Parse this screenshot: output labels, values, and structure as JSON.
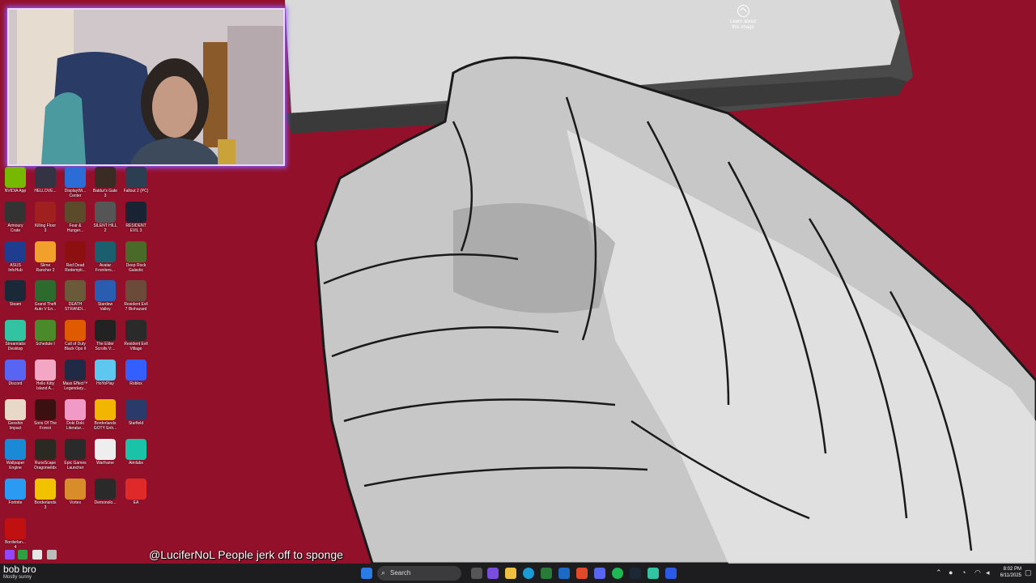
{
  "wallpaper": {
    "learn_label": "Learn about\nthis image"
  },
  "desktop_icons": [
    {
      "label": "NVIDIA App",
      "icon": "nvidia-icon",
      "color": "#76b900"
    },
    {
      "label": "HELLOVE...",
      "icon": "hellove-icon",
      "color": "#334"
    },
    {
      "label": "DisplayWi...\nCenter",
      "icon": "display-icon",
      "color": "#2b6cd6"
    },
    {
      "label": "Baldur's Gate\n3",
      "icon": "baldurs-gate-icon",
      "color": "#3a2b24"
    },
    {
      "label": "Fallout 2 (PC)",
      "icon": "fallout-icon",
      "color": "#2c3f52"
    },
    {
      "label": "Armoury\nCrate",
      "icon": "armoury-crate-icon",
      "color": "#333"
    },
    {
      "label": "Killing Floor\n3",
      "icon": "killing-floor-icon",
      "color": "#a02020"
    },
    {
      "label": "Fear &\nHunger...",
      "icon": "fear-hunger-icon",
      "color": "#5c4b2a"
    },
    {
      "label": "SILENT HILL\n2",
      "icon": "silent-hill-icon",
      "color": "#555"
    },
    {
      "label": "RESIDENT\nEVIL 3",
      "icon": "resident-evil-3-icon",
      "color": "#1a2333"
    },
    {
      "label": "ASUS\nInfoHub",
      "icon": "asus-icon",
      "color": "#1e3d8f"
    },
    {
      "label": "Slime\nRancher 2",
      "icon": "slime-rancher-icon",
      "color": "#f1a02b"
    },
    {
      "label": "Red Dead\nRedempti...",
      "icon": "red-dead-icon",
      "color": "#8c1010"
    },
    {
      "label": "Avatar\nFrontiers...",
      "icon": "avatar-icon",
      "color": "#1b5f6e"
    },
    {
      "label": "Deep Rock\nGalactic",
      "icon": "deep-rock-icon",
      "color": "#4a6a2a"
    },
    {
      "label": "Steam",
      "icon": "steam-icon",
      "color": "#1b2838"
    },
    {
      "label": "Grand Theft\nAuto V En...",
      "icon": "gta-icon",
      "color": "#2d6a2d"
    },
    {
      "label": "DEATH\nSTRANDI...",
      "icon": "death-stranding-icon",
      "color": "#6b5a3a"
    },
    {
      "label": "Stardew\nValley",
      "icon": "stardew-icon",
      "color": "#2a5db0"
    },
    {
      "label": "Resident Evil\n7 Biohazard",
      "icon": "resident-evil-7-icon",
      "color": "#6b4a3a"
    },
    {
      "label": "Streamlabs\nDesktop",
      "icon": "streamlabs-icon",
      "color": "#31c3a2"
    },
    {
      "label": "Schedule I",
      "icon": "schedule-icon",
      "color": "#4a8a2a"
    },
    {
      "label": "Call of Duty\nBlack Ops II",
      "icon": "cod-icon",
      "color": "#e05a00"
    },
    {
      "label": "The Elder\nScrolls V:...",
      "icon": "elder-scrolls-icon",
      "color": "#222"
    },
    {
      "label": "Resident Evil\nVillage",
      "icon": "resident-evil-village-icon",
      "color": "#2a2a2a"
    },
    {
      "label": "Discord",
      "icon": "discord-icon",
      "color": "#5865f2"
    },
    {
      "label": "Hello Kitty\nIsland A...",
      "icon": "hello-kitty-icon",
      "color": "#f4a7c4"
    },
    {
      "label": "Mass Effect™\nLegendary...",
      "icon": "mass-effect-icon",
      "color": "#202a44"
    },
    {
      "label": "HoYoPlay",
      "icon": "hoyoplay-icon",
      "color": "#5ec7f0"
    },
    {
      "label": "Roblox",
      "icon": "roblox-icon",
      "color": "#335fff"
    },
    {
      "label": "Genshin\nImpact",
      "icon": "genshin-icon",
      "color": "#e8d8c8"
    },
    {
      "label": "Sons Of The\nForest",
      "icon": "sons-forest-icon",
      "color": "#3a1010"
    },
    {
      "label": "Doki Doki\nLiteratur...",
      "icon": "doki-doki-icon",
      "color": "#f29ac7"
    },
    {
      "label": "Borderlands\nGOTY Enh...",
      "icon": "borderlands-goty-icon",
      "color": "#f2b600"
    },
    {
      "label": "Starfield",
      "icon": "starfield-icon",
      "color": "#2a3a6a"
    },
    {
      "label": "Wallpaper\nEngine",
      "icon": "wallpaper-engine-icon",
      "color": "#1a8ad6"
    },
    {
      "label": "RuneScape\nDragonwilds",
      "icon": "runescape-icon",
      "color": "#2a2a22"
    },
    {
      "label": "Epic Games\nLauncher",
      "icon": "epic-icon",
      "color": "#2a2a2a"
    },
    {
      "label": "Warframe",
      "icon": "warframe-icon",
      "color": "#eee"
    },
    {
      "label": "Aimlabs",
      "icon": "aimlabs-icon",
      "color": "#19c3a8"
    },
    {
      "label": "Fortnite",
      "icon": "fortnite-icon",
      "color": "#2b9af3"
    },
    {
      "label": "Borderlands\n3",
      "icon": "borderlands-3-icon",
      "color": "#f2c200"
    },
    {
      "label": "Vortex",
      "icon": "vortex-icon",
      "color": "#d98c2a"
    },
    {
      "label": "Demonolo...",
      "icon": "demonologist-icon",
      "color": "#2a2a2a"
    },
    {
      "label": "EA",
      "icon": "ea-icon",
      "color": "#e02a2a"
    },
    {
      "label": "Borderlan...\n4",
      "icon": "borderlands-4-icon",
      "color": "#c01010"
    }
  ],
  "chat": {
    "message": "@LuciferNoL People jerk off to sponge"
  },
  "taskbar": {
    "weather_title": "bob bro",
    "weather_sub": "Mostly sunny",
    "search_placeholder": "Search",
    "clock_time": "8:02 PM",
    "clock_date": "6/11/2025"
  }
}
